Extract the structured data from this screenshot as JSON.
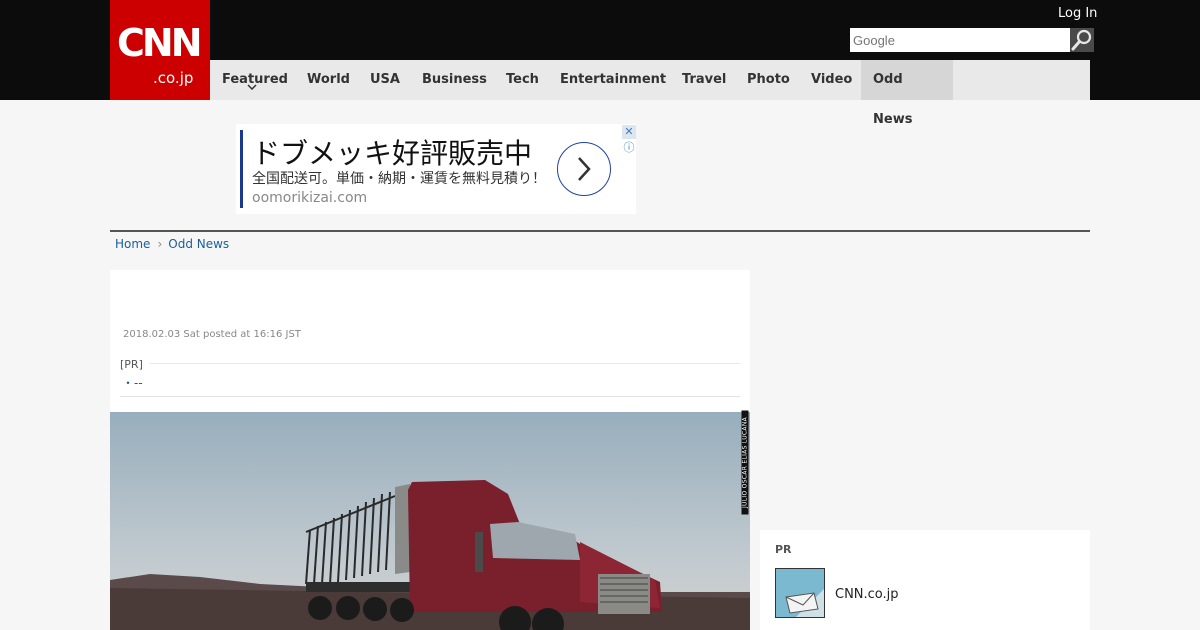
{
  "header": {
    "logo_main": "CNN",
    "logo_sub": ".co.jp",
    "login_label": "Log In",
    "search_placeholder": "Google"
  },
  "nav": {
    "items": [
      {
        "label": "Featured"
      },
      {
        "label": "World"
      },
      {
        "label": "USA"
      },
      {
        "label": "Business"
      },
      {
        "label": "Tech"
      },
      {
        "label": "Entertainment"
      },
      {
        "label": "Travel"
      },
      {
        "label": "Photo"
      },
      {
        "label": "Video"
      },
      {
        "label": "Odd News"
      }
    ],
    "active": "Odd News"
  },
  "ad": {
    "headline": "ドブメッキ好評販売中",
    "body": "全国配送可。単価・納期・運賃を無料見積り！",
    "domain": "oomorikizai.com"
  },
  "breadcrumb": {
    "home": "Home",
    "section": "Odd News"
  },
  "article": {
    "date": "2018.02.03 Sat posted at 16:16 JST",
    "pr_label": "[PR]",
    "pr_link": "・--",
    "photo_credit": "JULIO OSCAR ELIAS LUCANA"
  },
  "sidebar": {
    "pr_label": "PR",
    "item_name": "CNN.co.jp"
  },
  "colors": {
    "brand_red": "#cc0000",
    "topbar": "#0c0c0c",
    "link": "#1a5e9c"
  }
}
